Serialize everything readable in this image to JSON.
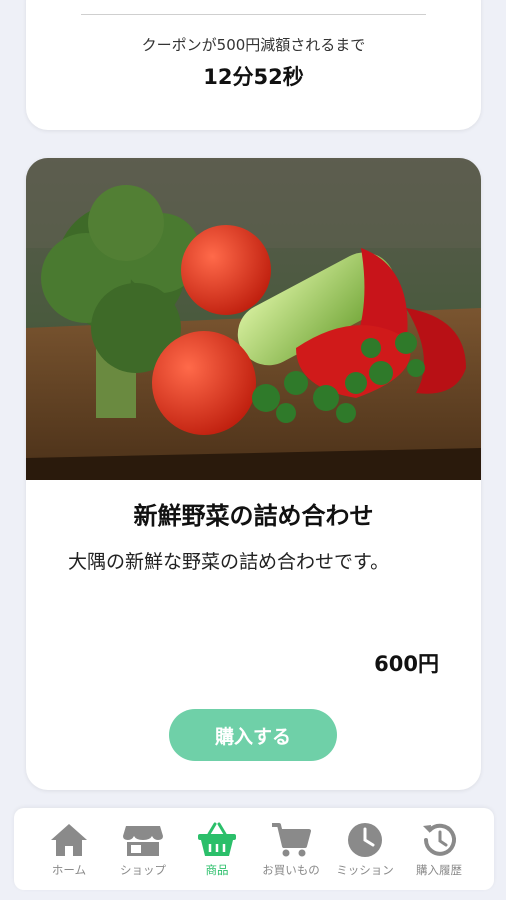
{
  "coupon": {
    "message": "クーポンが500円減額されるまで",
    "time_remaining": "12分52秒"
  },
  "product": {
    "image_alt": "vegetables",
    "name": "新鮮野菜の詰め合わせ",
    "description": "大隅の新鮮な野菜の詰め合わせです。",
    "price": "600円",
    "buy_label": "購入する"
  },
  "nav": {
    "items": [
      {
        "label": "ホーム",
        "icon": "home-icon"
      },
      {
        "label": "ショップ",
        "icon": "shop-icon"
      },
      {
        "label": "商品",
        "icon": "basket-icon",
        "active": true
      },
      {
        "label": "お買いもの",
        "icon": "cart-icon"
      },
      {
        "label": "ミッション",
        "icon": "clock-icon"
      },
      {
        "label": "購入履歴",
        "icon": "history-icon"
      }
    ]
  },
  "colors": {
    "accent_green": "#2bbf6a",
    "button_green": "#6fd0a8",
    "nav_gray": "#8a8a8a",
    "background": "#eef0f7"
  }
}
